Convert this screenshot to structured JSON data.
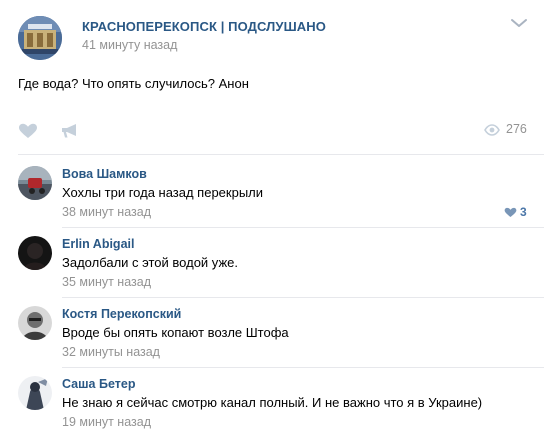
{
  "post": {
    "group_name": "КРАСНОПЕРЕКОПСК | ПОДСЛУШАНО",
    "time": "41 минуту назад",
    "text": "Где вода? Что опять случилось? Анон",
    "views": "276",
    "icons": {
      "like": "heart-icon",
      "share": "megaphone-icon",
      "views": "eye-icon",
      "more": "chevron-down-icon"
    }
  },
  "comments": [
    {
      "author": "Вова Шамков",
      "text": "Хохлы три года назад перекрыли",
      "time": "38 минут назад",
      "likes": "3"
    },
    {
      "author": "Erlin Abigail",
      "text": "Задолбали с этой водой уже.",
      "time": "35 минут назад"
    },
    {
      "author": "Костя Перекопский",
      "text": "Вроде бы опять копают возле Штофа",
      "time": "32 минуты назад"
    },
    {
      "author": "Саша Бетер",
      "text": "Не знаю я сейчас смотрю канал полный. И не важно что я в Украине)",
      "time": "19 минут назад"
    }
  ],
  "colors": {
    "link": "#2a5885",
    "accent": "#4a76a8",
    "muted": "#939393",
    "icon": "#c5d0db",
    "divider": "#e7e8ec"
  }
}
